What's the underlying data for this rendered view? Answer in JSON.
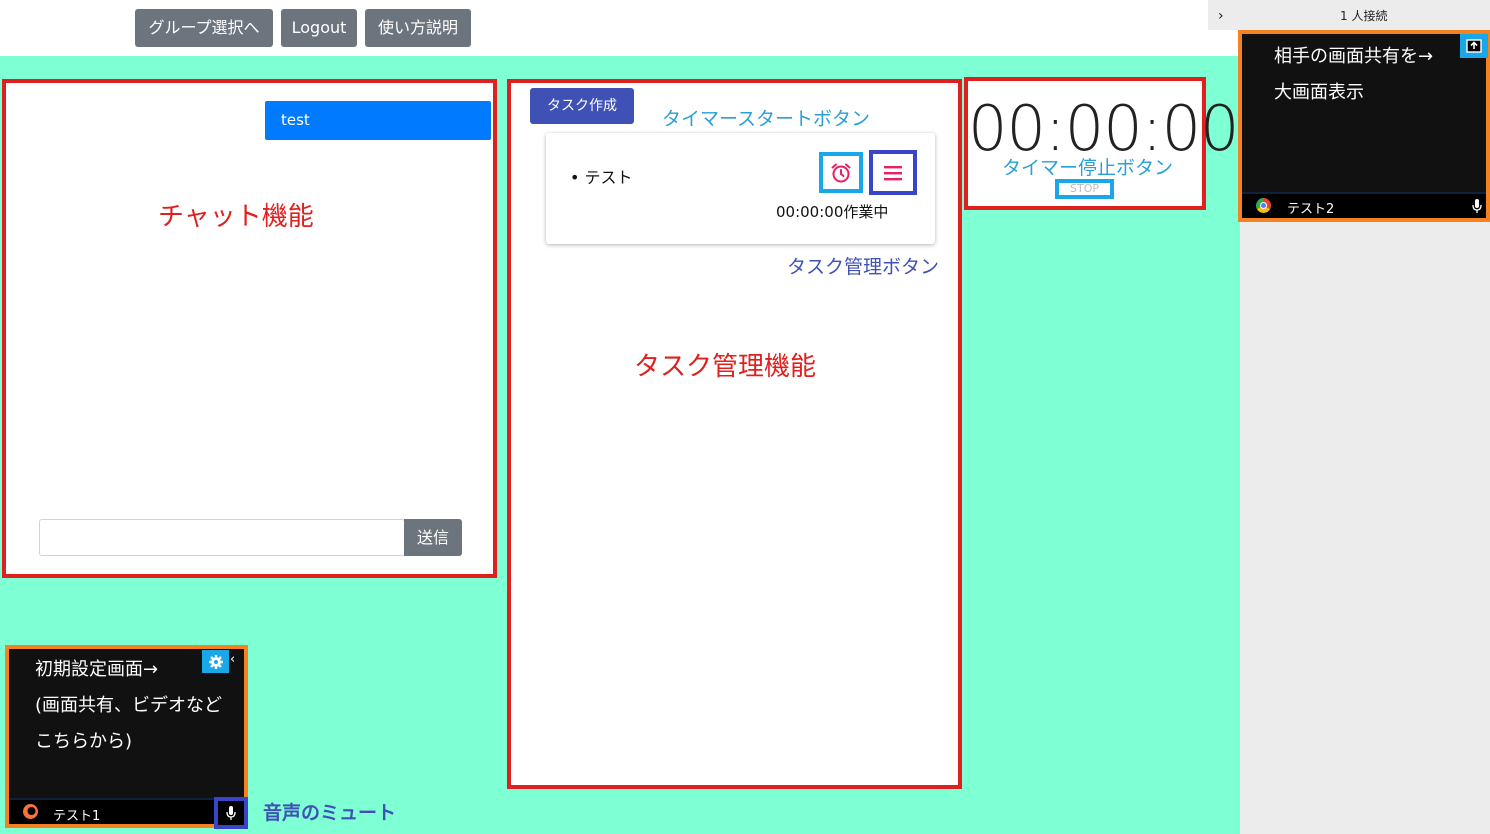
{
  "nav": {
    "group_select": "グループ選択へ",
    "logout": "Logout",
    "howto": "使い方説明"
  },
  "connection": {
    "count_label": "1 人接続"
  },
  "chat": {
    "message": "test",
    "input_value": "",
    "send_label": "送信",
    "annotation": "チャット機能"
  },
  "task": {
    "create_label": "タスク作成",
    "timer_start_annotation": "タイマースタートボタン",
    "item_name": "テスト",
    "item_status": "00:00:00作業中",
    "manage_button_annotation": "タスク管理ボタン",
    "area_annotation": "タスク管理機能"
  },
  "timer": {
    "display": "00:00:00",
    "stop_annotation": "タイマー停止ボタン",
    "stop_label": "STOP"
  },
  "remote_video": {
    "text_line1": "相手の画面共有を→",
    "text_line2": "大画面表示",
    "user_name": "テスト2"
  },
  "local_video": {
    "text_line1": "初期設定画面→",
    "text_line2": "(画面共有、ビデオなど",
    "text_line3": "こちらから)",
    "user_name": "テスト1",
    "mute_annotation": "音声のミュート"
  },
  "colors": {
    "background": "#7fffd4",
    "annotation_red": "#e0201f",
    "annotation_blue": "#2a9fd6",
    "annotation_indigo": "#3f51b5",
    "highlight_orange": "#f58220"
  }
}
